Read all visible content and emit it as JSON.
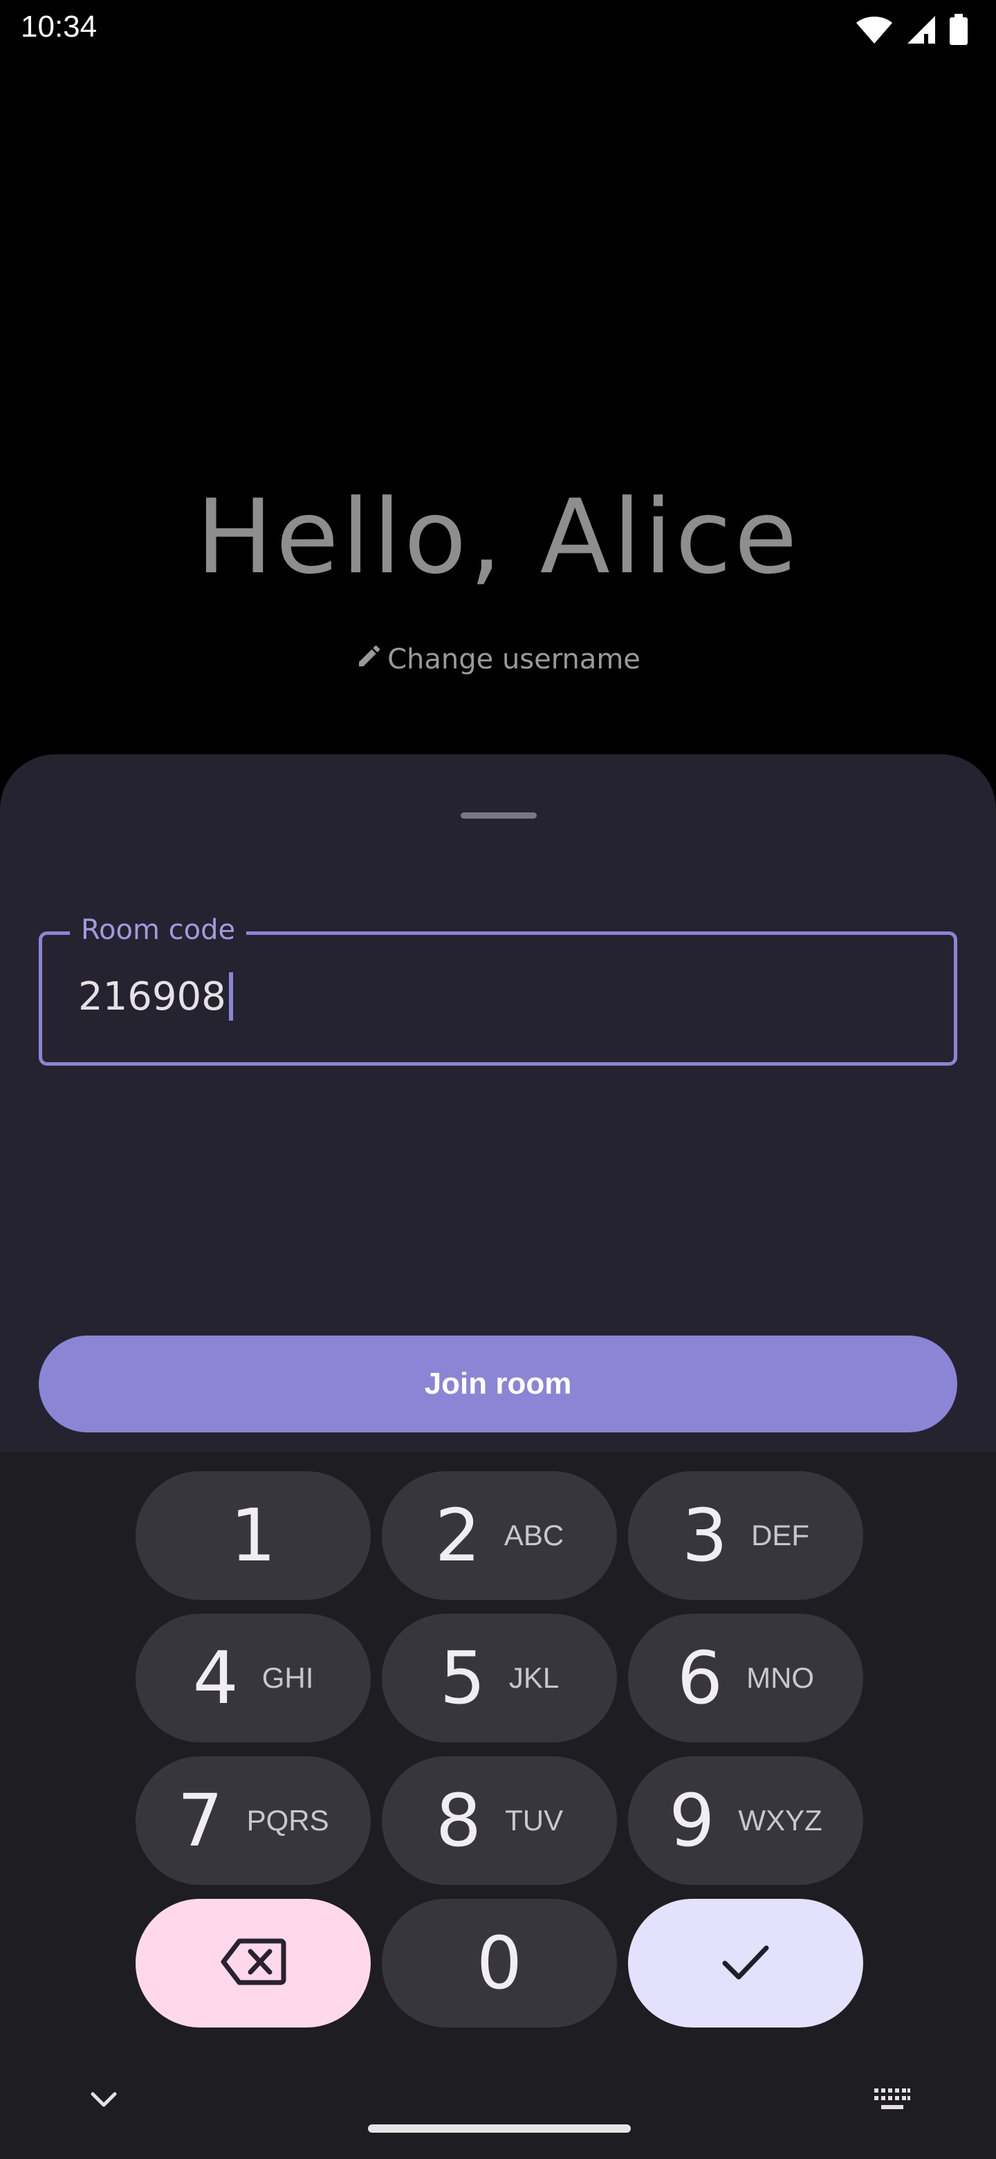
{
  "status_bar": {
    "time": "10:34",
    "icons": [
      "wifi-icon",
      "signal-icon",
      "battery-icon"
    ]
  },
  "greeting": {
    "text": "Hello, Alice",
    "change_username_label": "Change username",
    "change_username_icon": "pencil-icon"
  },
  "room_form": {
    "label": "Room code",
    "value": "216908",
    "join_button_label": "Join room"
  },
  "keyboard": {
    "keys": [
      {
        "digit": "1",
        "letters": ""
      },
      {
        "digit": "2",
        "letters": "ABC"
      },
      {
        "digit": "3",
        "letters": "DEF"
      },
      {
        "digit": "4",
        "letters": "GHI"
      },
      {
        "digit": "5",
        "letters": "JKL"
      },
      {
        "digit": "6",
        "letters": "MNO"
      },
      {
        "digit": "7",
        "letters": "PQRS"
      },
      {
        "digit": "8",
        "letters": "TUV"
      },
      {
        "digit": "9",
        "letters": "WXYZ"
      },
      {
        "digit": "0",
        "letters": ""
      }
    ],
    "delete_icon": "backspace-icon",
    "enter_icon": "check-icon",
    "hide_icon": "chevron-down-icon",
    "switch_icon": "keyboard-icon"
  },
  "colors": {
    "accent": "#8b85d6",
    "sheet": "#25232f",
    "keyboard": "#1e1d22",
    "delete_key": "#ffd8ec",
    "enter_key": "#e3e1fc"
  }
}
